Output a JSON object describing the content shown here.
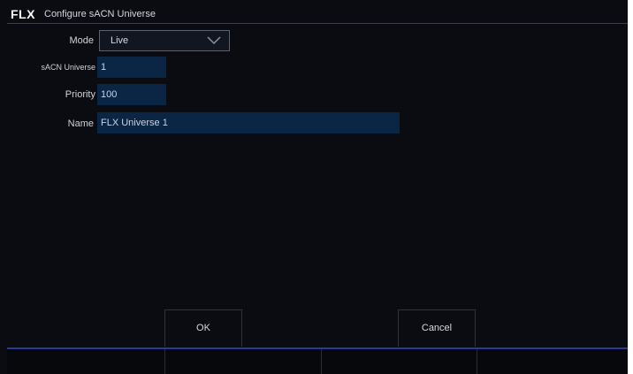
{
  "window": {
    "logo": "FLX",
    "title": "Configure sACN Universe"
  },
  "form": {
    "mode": {
      "label": "Mode",
      "value": "Live"
    },
    "universe": {
      "label": "sACN Universe",
      "value": "1"
    },
    "priority": {
      "label": "Priority",
      "value": "100"
    },
    "name": {
      "label": "Name",
      "value": "FLX Universe 1"
    }
  },
  "buttons": {
    "ok": "OK",
    "cancel": "Cancel"
  },
  "colors": {
    "background": "#0b0c12",
    "field": "#0b2545",
    "accent_line": "#2b3a9a"
  },
  "icons": {
    "dropdown": "chevron-down-icon"
  }
}
